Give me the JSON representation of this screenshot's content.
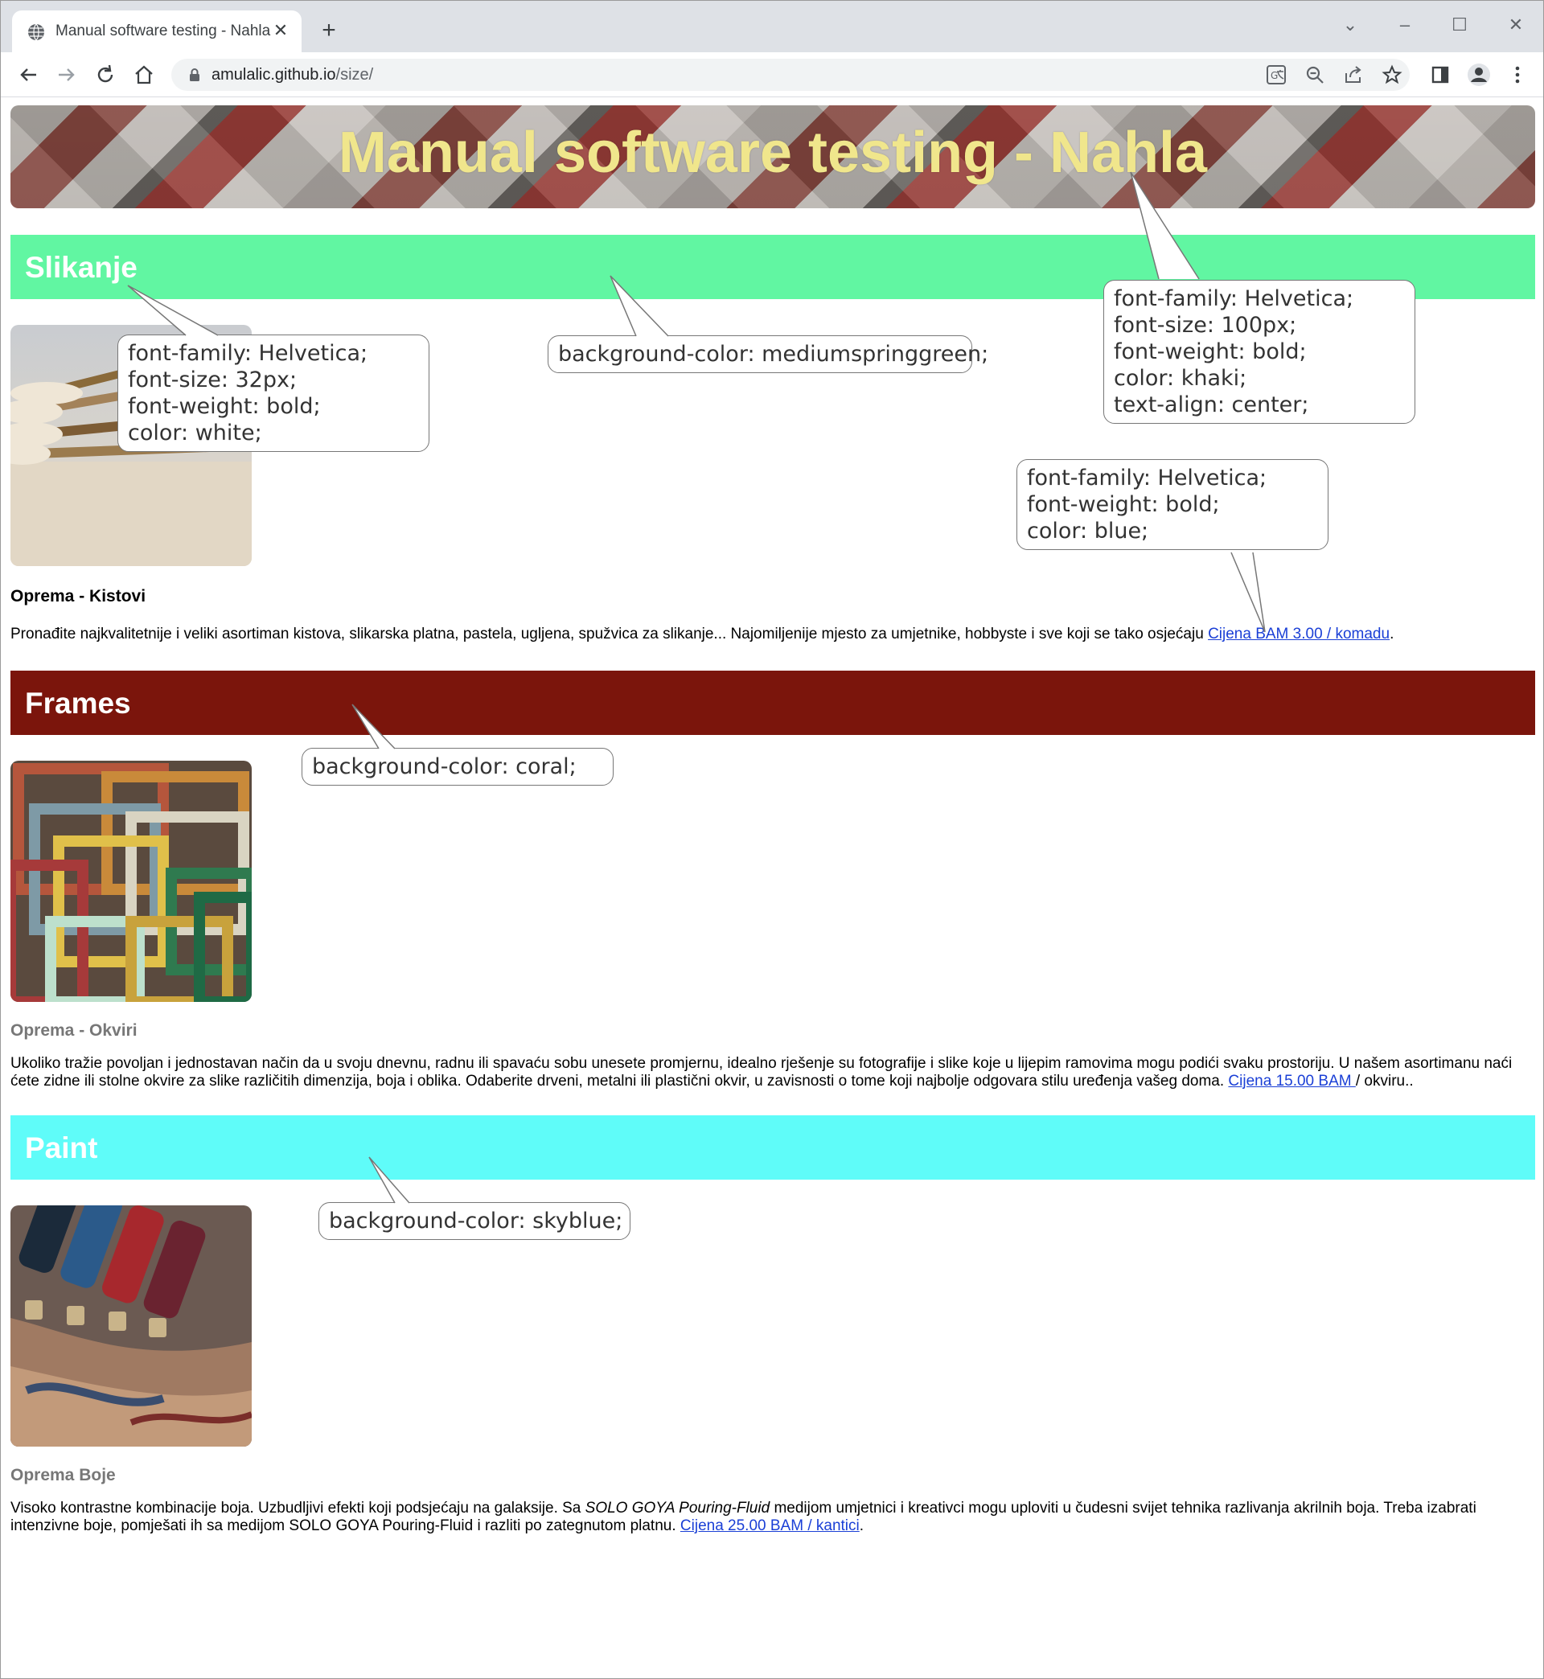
{
  "browser": {
    "tab_title": "Manual software testing - Nahla",
    "url_host": "amulalic.github.io",
    "url_path": "/size/"
  },
  "header": {
    "title": "Manual software testing - Nahla"
  },
  "sections": [
    {
      "title": "Slikanje",
      "bar_color": "#61f6a2",
      "subhead": "Oprema - Kistovi",
      "subhead_color": "#000000",
      "text_before": "Pronađite najkvalitetnije i veliki asortiman kistova, slikarska platna, pastela, ugljena, spužvica za slikanje... Najomiljenije mjesto za umjetnike, hobbyste i sve koji se tako osjećaju ",
      "link": "Cijena BAM 3.00 / komadu",
      "text_after": "."
    },
    {
      "title": "Frames",
      "bar_color": "#7b150c",
      "subhead": "Oprema - Okviri",
      "subhead_color": "#777777",
      "text_before": "Ukoliko tražie povoljan i jednostavan način da u svoju dnevnu, radnu ili spavaću sobu unesete promjernu, idealno rješenje su fotografije i slike koje u lijepim ramovima mogu podići svaku prostoriju. U našem asortimanu naći ćete zidne ili stolne okvire za slike različitih dimenzija, boja i oblika. Odaberite drveni, metalni ili plastični okvir, u zavisnosti o tome koji najbolje odgovara stilu uređenja vašeg doma. ",
      "link": "Cijena 15.00 BAM ",
      "text_after": "/ okviru.."
    },
    {
      "title": "Paint",
      "bar_color": "#5ffcf9",
      "subhead": "Oprema Boje",
      "subhead_color": "#777777",
      "text_before": "Visoko kontrastne kombinacije boja. Uzbudljivi efekti koji podsjećaju na galaksije. Sa ",
      "italic": "SOLO GOYA Pouring-Fluid",
      "text_middle": " medijom umjetnici i kreativci mogu uploviti u čudesni svijet tehnika razlivanja akrilnih boja. Treba izabrati intenzivne boje, pomješati ih sa medijom SOLO GOYA Pouring-Fluid i razliti po zategnutom platnu. ",
      "link": "Cijena 25.00 BAM / kantici",
      "text_after": "."
    }
  ],
  "callouts": {
    "title_style": [
      "font-family: Helvetica;",
      "font-size: 100px;",
      "font-weight: bold;",
      "color: khaki;",
      "text-align: center;"
    ],
    "section_style": [
      "font-family: Helvetica;",
      "font-size: 32px;",
      "font-weight: bold;",
      "color: white;"
    ],
    "green_bg": [
      "background-color: mediumspringgreen;"
    ],
    "link_style": [
      "font-family: Helvetica;",
      "font-weight: bold;",
      "color: blue;"
    ],
    "coral_bg": [
      "background-color: coral;"
    ],
    "skyblue_bg": [
      "background-color: skyblue;"
    ]
  }
}
